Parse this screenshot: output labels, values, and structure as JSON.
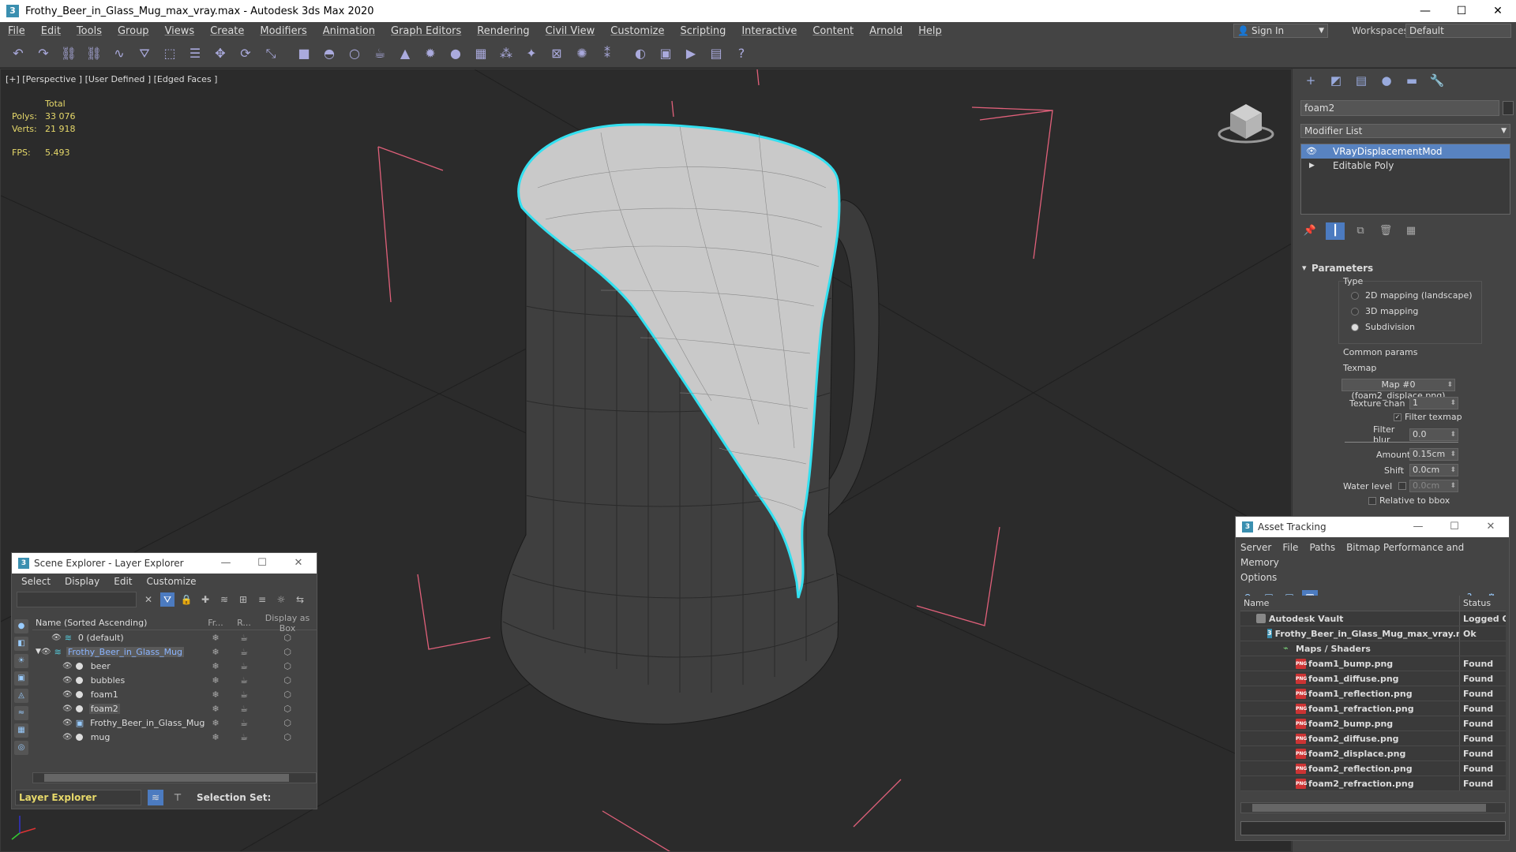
{
  "window": {
    "title": "Frothy_Beer_in_Glass_Mug_max_vray.max - Autodesk 3ds Max 2020",
    "icon": "3"
  },
  "menu": [
    "File",
    "Edit",
    "Tools",
    "Group",
    "Views",
    "Create",
    "Modifiers",
    "Animation",
    "Graph Editors",
    "Rendering",
    "Civil View",
    "Customize",
    "Scripting",
    "Interactive",
    "Content",
    "Arnold",
    "Help"
  ],
  "account": {
    "sign_in": "Sign In",
    "workspaces_label": "Workspaces:",
    "workspace": "Default"
  },
  "toolbar_icons": [
    "undo-icon",
    "redo-icon",
    "select-link-icon",
    "unlink-icon",
    "bind-space-warp-icon",
    "select-filter-icon",
    "select-object-icon",
    "select-by-name-icon",
    "move-icon",
    "rotate-icon",
    "scale-icon",
    "box-icon",
    "sphere-icon",
    "cylinder-icon",
    "teapot-icon",
    "cone-icon",
    "light-icon",
    "omni-icon",
    "grid-icon",
    "particles-icon",
    "bones-icon",
    "lattice-icon",
    "hair-icon",
    "fur-icon",
    "material-icon",
    "render-setup-icon",
    "render-icon",
    "frame-buffer-icon",
    "help-icon"
  ],
  "viewport": {
    "label": "[+] [Perspective ] [User Defined ] [Edged Faces ]",
    "stats": {
      "header": "Total",
      "polys_label": "Polys:",
      "polys": "33 076",
      "verts_label": "Verts:",
      "verts": "21 918",
      "fps_label": "FPS:",
      "fps": "5.493"
    }
  },
  "command_panel": {
    "object_name": "foam2",
    "modifier_list": "Modifier List",
    "stack": [
      {
        "label": "VRayDisplacementMod",
        "selected": true
      },
      {
        "label": "Editable Poly",
        "selected": false
      }
    ],
    "parameters": {
      "title": "Parameters",
      "type_label": "Type",
      "type_options": [
        "2D mapping (landscape)",
        "3D mapping",
        "Subdivision"
      ],
      "type_selected": "Subdivision",
      "common_params": "Common params",
      "texmap_label": "Texmap",
      "texmap_value": "Map #0 (foam2_displace.png)",
      "texture_chan_label": "Texture chan",
      "texture_chan": "1",
      "filter_texmap": "Filter texmap",
      "filter_blur_label": "Filter blur",
      "filter_blur": "0.0",
      "amount_label": "Amount",
      "amount": "0.15cm",
      "shift_label": "Shift",
      "shift": "0.0cm",
      "water_level_label": "Water level",
      "water_level": "0.0cm",
      "relative_bbox": "Relative to bbox"
    }
  },
  "scene_explorer": {
    "title": "Scene Explorer - Layer Explorer",
    "menu": [
      "Select",
      "Display",
      "Edit",
      "Customize"
    ],
    "columns": {
      "name": "Name (Sorted Ascending)",
      "fr": "Fr...",
      "r": "R...",
      "box": "Display as Box"
    },
    "rows": [
      {
        "name": "0 (default)",
        "indent": 1,
        "kind": "layer"
      },
      {
        "name": "Frothy_Beer_in_Glass_Mug",
        "indent": 0,
        "kind": "layer-open"
      },
      {
        "name": "beer",
        "indent": 2,
        "kind": "object"
      },
      {
        "name": "bubbles",
        "indent": 2,
        "kind": "object"
      },
      {
        "name": "foam1",
        "indent": 2,
        "kind": "object"
      },
      {
        "name": "foam2",
        "indent": 2,
        "kind": "object-selected"
      },
      {
        "name": "Frothy_Beer_in_Glass_Mug",
        "indent": 2,
        "kind": "group"
      },
      {
        "name": "mug",
        "indent": 2,
        "kind": "object"
      }
    ],
    "bottom_layer": "Layer Explorer",
    "selection_set": "Selection Set:"
  },
  "asset_tracking": {
    "title": "Asset Tracking",
    "menu": [
      "Server",
      "File",
      "Paths",
      "Bitmap Performance and Memory",
      "Options"
    ],
    "columns": {
      "name": "Name",
      "status": "Status"
    },
    "rows": [
      {
        "name": "Autodesk Vault",
        "status": "Logged Ou",
        "indent": 20,
        "icon": "vault"
      },
      {
        "name": "Frothy_Beer_in_Glass_Mug_max_vray.max",
        "status": "Ok",
        "indent": 34,
        "icon": "max"
      },
      {
        "name": "Maps / Shaders",
        "status": "",
        "indent": 54,
        "icon": "map"
      },
      {
        "name": "foam1_bump.png",
        "status": "Found",
        "indent": 70,
        "icon": "png"
      },
      {
        "name": "foam1_diffuse.png",
        "status": "Found",
        "indent": 70,
        "icon": "png"
      },
      {
        "name": "foam1_reflection.png",
        "status": "Found",
        "indent": 70,
        "icon": "png"
      },
      {
        "name": "foam1_refraction.png",
        "status": "Found",
        "indent": 70,
        "icon": "png"
      },
      {
        "name": "foam2_bump.png",
        "status": "Found",
        "indent": 70,
        "icon": "png"
      },
      {
        "name": "foam2_diffuse.png",
        "status": "Found",
        "indent": 70,
        "icon": "png"
      },
      {
        "name": "foam2_displace.png",
        "status": "Found",
        "indent": 70,
        "icon": "png"
      },
      {
        "name": "foam2_reflection.png",
        "status": "Found",
        "indent": 70,
        "icon": "png"
      },
      {
        "name": "foam2_refraction.png",
        "status": "Found",
        "indent": 70,
        "icon": "png"
      }
    ]
  },
  "colors": {
    "selection": "#5883c1",
    "stats": "#e6d86a",
    "highlight_outline": "#33e0f0",
    "bbox_lines": "#e0607a"
  }
}
